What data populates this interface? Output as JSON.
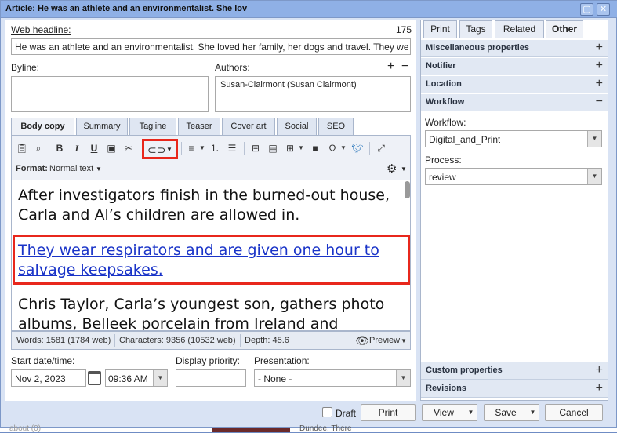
{
  "window": {
    "title": "Article: He was an athlete and an environmentalist. She lov"
  },
  "headline": {
    "label": "Web headline:",
    "count": "175",
    "value": "He was an athlete and an environmentalist. She loved her family, her dogs and travel. They were"
  },
  "byline": {
    "label": "Byline:",
    "value": ""
  },
  "authors": {
    "label": "Authors:",
    "add_icon": "+",
    "remove_icon": "−",
    "items": [
      "Susan-Clairmont (Susan Clairmont)"
    ]
  },
  "editor_tabs": [
    "Body copy",
    "Summary",
    "Tagline",
    "Teaser",
    "Cover art",
    "Social",
    "SEO"
  ],
  "format": {
    "label": "Format:",
    "value": "Normal text"
  },
  "body": {
    "p1": "After investigators finish in the burned-out house, Carla and Al’s children are allowed in.",
    "p2": "They wear respirators and are given one hour to salvage keepsakes.",
    "p3": "Chris Taylor, Carla’s youngest son, gathers photo albums, Belleek porcelain from Ireland and"
  },
  "status": {
    "words": "Words: 1581 (1784 web)",
    "characters": "Characters: 9356 (10532 web)",
    "depth": "Depth: 45.6",
    "preview": "Preview"
  },
  "schedule": {
    "start_label": "Start date/time:",
    "date": "Nov 2, 2023",
    "time": "09:36 AM",
    "priority_label": "Display priority:",
    "priority": "",
    "presentation_label": "Presentation:",
    "presentation": "- None -"
  },
  "right_tabs": [
    "Print",
    "Tags",
    "Related",
    "Other"
  ],
  "sections": {
    "misc": "Miscellaneous properties",
    "notifier": "Notifier",
    "location": "Location",
    "workflow": "Workflow",
    "custom": "Custom properties",
    "revisions": "Revisions"
  },
  "workflow": {
    "workflow_label": "Workflow:",
    "workflow_value": "Digital_and_Print",
    "process_label": "Process:",
    "process_value": "review"
  },
  "footer": {
    "draft": "Draft",
    "print": "Print",
    "view": "View",
    "save": "Save",
    "cancel": "Cancel"
  },
  "background": {
    "text1": "about (0)",
    "text2": "Dundee. There"
  }
}
